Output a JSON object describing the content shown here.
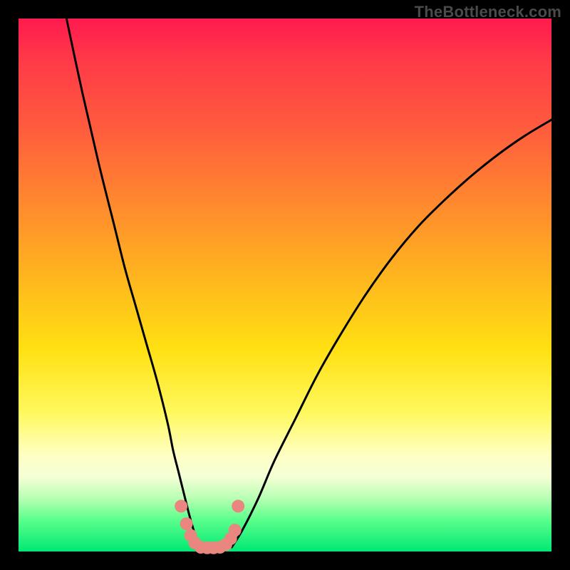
{
  "watermark": "TheBottleneck.com",
  "colors": {
    "frame": "#000000",
    "curve": "#000000",
    "marker": "#e9867f",
    "gradient_stops": [
      "#ff1a4f",
      "#ff5a3e",
      "#ffb41f",
      "#fff95e",
      "#ffffc4",
      "#5cff8c",
      "#00e874"
    ]
  },
  "chart_data": {
    "type": "line",
    "title": "",
    "xlabel": "",
    "ylabel": "",
    "xlim": [
      0,
      100
    ],
    "ylim": [
      0,
      100
    ],
    "note": "No axis ticks or numeric labels are visible in the image; x/y units are proportional (0-100 = full plot width/height). y=0 at bottom, y=100 at top.",
    "series": [
      {
        "name": "left-branch",
        "x": [
          9,
          12,
          15,
          18,
          20,
          22,
          24,
          26,
          28,
          29,
          30,
          31,
          32,
          33,
          33.8
        ],
        "y": [
          100,
          86,
          73,
          61,
          53,
          46,
          39,
          32,
          24,
          19,
          15,
          11,
          7,
          3.5,
          0.8
        ]
      },
      {
        "name": "right-branch",
        "x": [
          40,
          42,
          45,
          48,
          52,
          56,
          60,
          65,
          70,
          75,
          80,
          85,
          90,
          95,
          100
        ],
        "y": [
          0.8,
          4,
          10,
          17,
          25,
          33,
          40,
          48,
          55,
          61,
          66,
          70.5,
          74.5,
          78,
          81
        ]
      },
      {
        "name": "bottom-markers",
        "marker_only": true,
        "x": [
          30.5,
          31.5,
          32.3,
          33.1,
          34.2,
          35.4,
          36.6,
          37.8,
          38.9,
          39.8,
          40.6,
          41.2
        ],
        "y": [
          8.5,
          5.2,
          3.0,
          1.6,
          0.8,
          0.7,
          0.7,
          0.8,
          1.3,
          2.4,
          4.0,
          8.5
        ]
      }
    ]
  }
}
